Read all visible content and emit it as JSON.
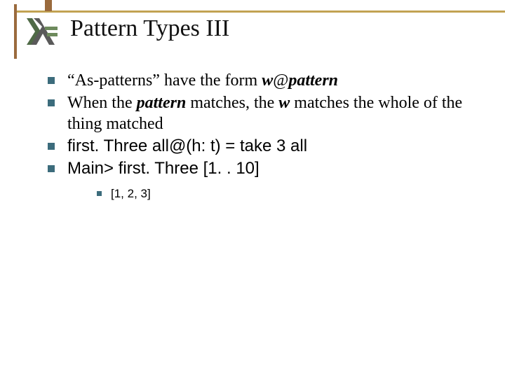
{
  "title": "Pattern Types III",
  "bullets": {
    "b1_a": "“As-patterns” have the form ",
    "b1_b": "w",
    "b1_c": "@",
    "b1_d": "pattern",
    "b2_a": "When the ",
    "b2_b": "pattern",
    "b2_c": " matches, the ",
    "b2_d": "w",
    "b2_e": " matches the whole of the thing matched",
    "b3": "first. Three all@(h: t) = take 3 all",
    "b4": "Main> first. Three [1. . 10]",
    "sub1": "[1, 2, 3]"
  },
  "colors": {
    "bullet_square": "#3c6c7c",
    "deco_gold": "#c2a252",
    "deco_brown": "#9a6a3d"
  }
}
